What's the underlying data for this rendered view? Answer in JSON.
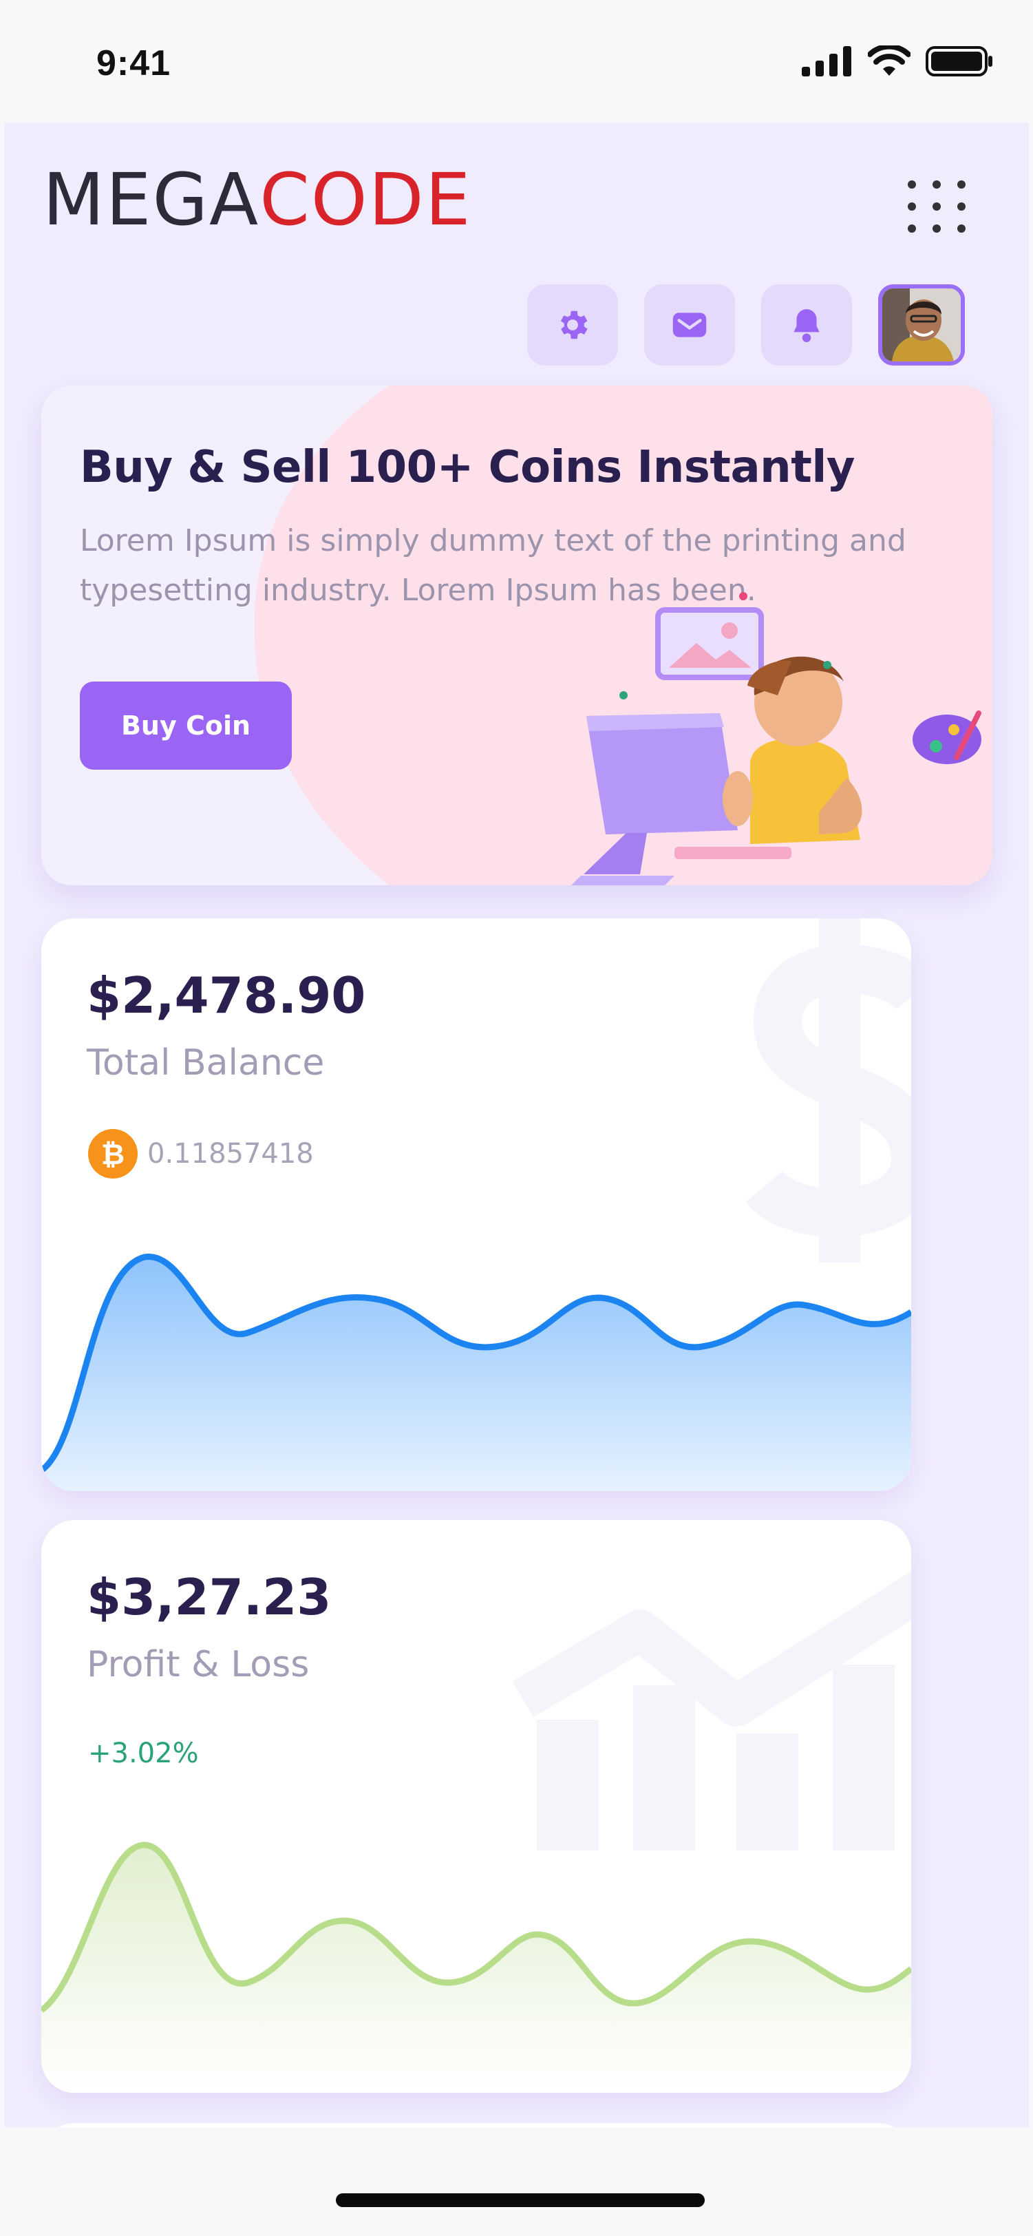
{
  "status_bar": {
    "time": "9:41",
    "icons": [
      "signal-icon",
      "wifi-icon",
      "battery-icon"
    ]
  },
  "header": {
    "logo_part1": "MEGA",
    "logo_part2": "CODE",
    "menu_icon": "grid-menu-icon",
    "action_icons": [
      "gear-icon",
      "mail-icon",
      "bell-icon"
    ],
    "avatar_alt": "user avatar"
  },
  "banner": {
    "title": "Buy & Sell 100+ Coins Instantly",
    "text": "Lorem Ipsum is simply dummy text of the printing and typesetting industry. Lorem Ipsum has been.",
    "button_label": "Buy Coin"
  },
  "balance_card": {
    "amount": "$2,478.90",
    "label": "Total Balance",
    "btc_symbol": "₿",
    "btc_amount": "0.11857418"
  },
  "profit_card": {
    "amount": "$3,27.23",
    "label": "Profit & Loss",
    "change": "+3.02%"
  },
  "colors": {
    "brand_dark": "#2b2b3a",
    "brand_red": "#d8232a",
    "accent_purple": "#9a64f4",
    "balance_line": "#1b84f0",
    "profit_line": "#b7dd8a",
    "positive": "#2aa37a"
  }
}
